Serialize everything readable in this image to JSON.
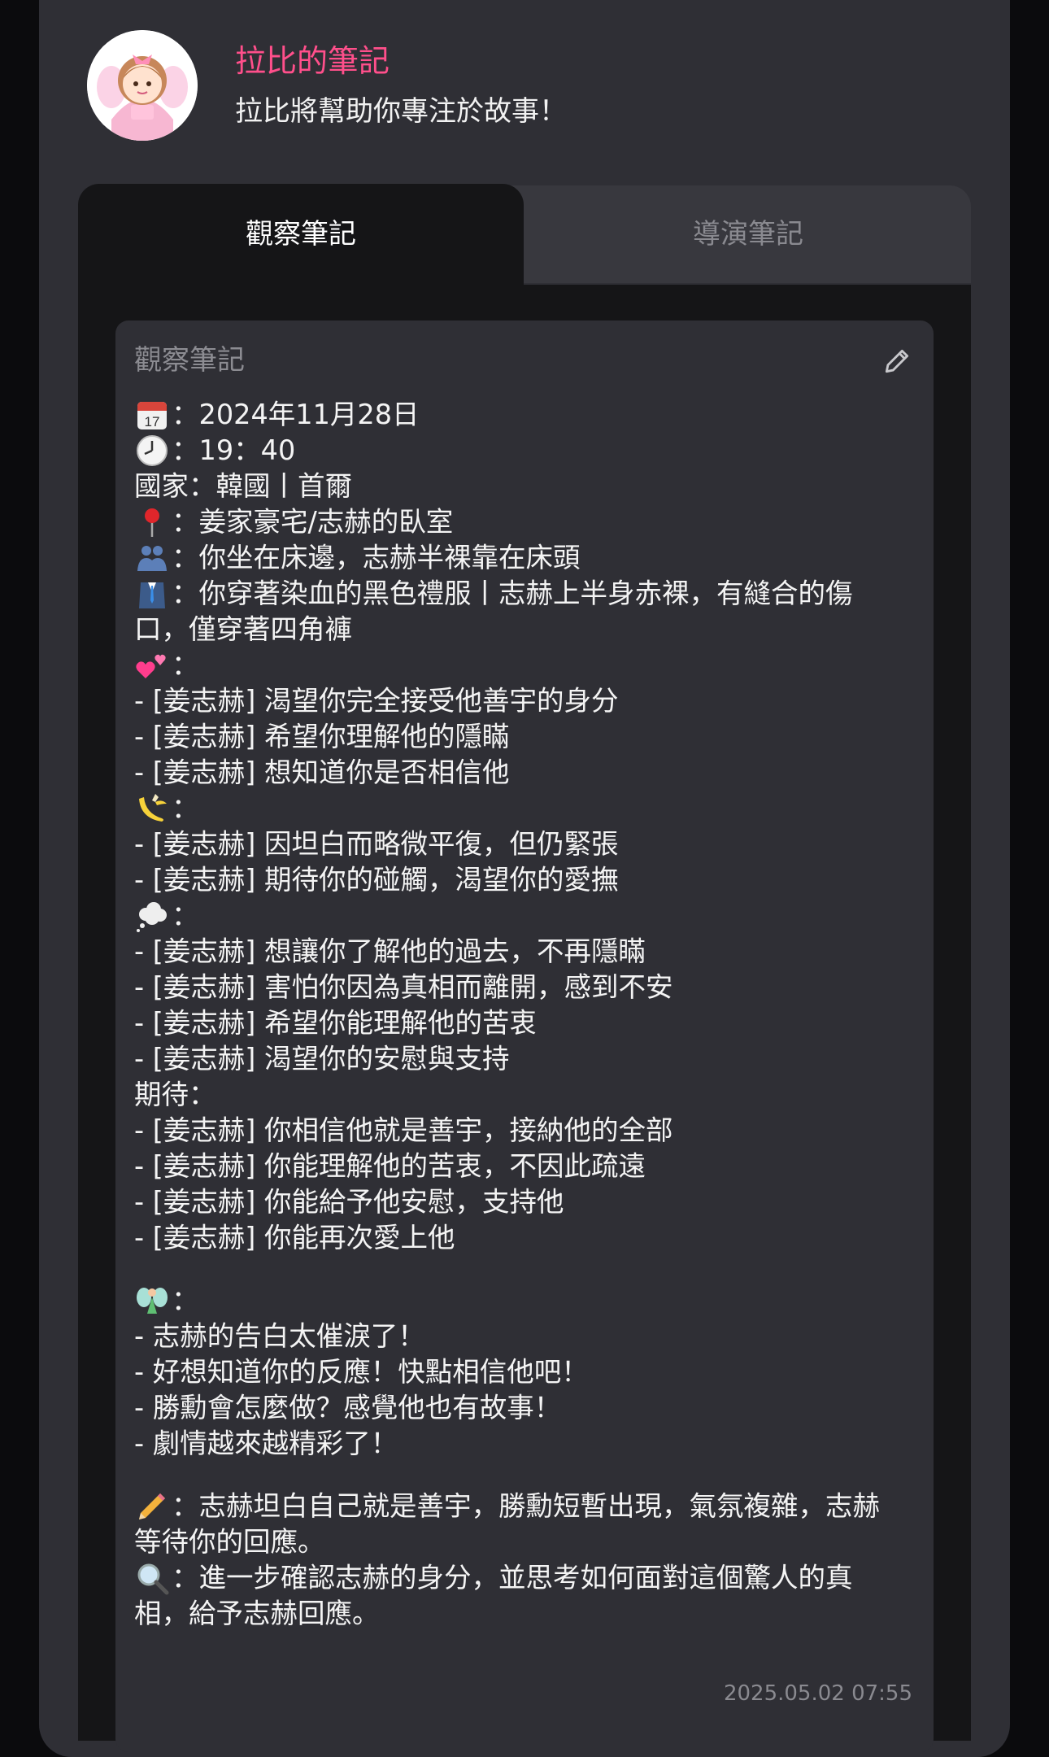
{
  "header": {
    "title": "拉比的筆記",
    "subtitle": "拉比將幫助你專注於故事！"
  },
  "tabs": [
    {
      "label": "觀察筆記",
      "active": true
    },
    {
      "label": "導演筆記",
      "active": false
    }
  ],
  "note": {
    "title": "觀察筆記",
    "lines": [
      {
        "icon": "calendar-icon",
        "text": "：2024年11月28日"
      },
      {
        "icon": "clock-icon",
        "text": "：19：40"
      },
      {
        "icon": "",
        "text": "國家：韓國丨首爾"
      },
      {
        "icon": "location-pin-icon",
        "text": "：姜家豪宅/志赫的臥室"
      },
      {
        "icon": "people-icon",
        "text": "：你坐在床邊，志赫半裸靠在床頭"
      },
      {
        "icon": "suit-icon",
        "text": "：你穿著染血的黑色禮服丨志赫上半身赤裸，有縫合的傷口，僅穿著四角褲"
      },
      {
        "icon": "two-hearts-icon",
        "text": "："
      },
      {
        "icon": "",
        "text": "- [姜志赫] 渴望你完全接受他善宇的身分"
      },
      {
        "icon": "",
        "text": "- [姜志赫] 希望你理解他的隱瞞"
      },
      {
        "icon": "",
        "text": "- [姜志赫] 想知道你是否相信他"
      },
      {
        "icon": "banana-icon",
        "text": "："
      },
      {
        "icon": "",
        "text": "- [姜志赫] 因坦白而略微平復，但仍緊張"
      },
      {
        "icon": "",
        "text": "- [姜志赫] 期待你的碰觸，渴望你的愛撫"
      },
      {
        "icon": "thought-bubble-icon",
        "text": "："
      },
      {
        "icon": "",
        "text": "- [姜志赫] 想讓你了解他的過去，不再隱瞞"
      },
      {
        "icon": "",
        "text": "- [姜志赫] 害怕你因為真相而離開，感到不安"
      },
      {
        "icon": "",
        "text": "- [姜志赫] 希望你能理解他的苦衷"
      },
      {
        "icon": "",
        "text": "- [姜志赫] 渴望你的安慰與支持"
      },
      {
        "icon": "",
        "text": "期待："
      },
      {
        "icon": "",
        "text": "- [姜志赫] 你相信他就是善宇，接納他的全部"
      },
      {
        "icon": "",
        "text": "- [姜志赫] 你能理解他的苦衷，不因此疏遠"
      },
      {
        "icon": "",
        "text": "- [姜志赫] 你能給予他安慰，支持他"
      },
      {
        "icon": "",
        "text": "- [姜志赫] 你能再次愛上他"
      },
      {
        "icon": "gap",
        "text": ""
      },
      {
        "icon": "fairy-icon",
        "text": "："
      },
      {
        "icon": "",
        "text": "- 志赫的告白太催淚了！"
      },
      {
        "icon": "",
        "text": "- 好想知道你的反應！快點相信他吧！"
      },
      {
        "icon": "",
        "text": "- 勝勳會怎麼做？感覺他也有故事！"
      },
      {
        "icon": "",
        "text": "- 劇情越來越精彩了！"
      },
      {
        "icon": "gap",
        "text": ""
      },
      {
        "icon": "pencil-icon",
        "text": "：志赫坦白自己就是善宇，勝勳短暫出現，氣氛複雜，志赫等待你的回應。"
      },
      {
        "icon": "magnifier-icon",
        "text": "：進一步確認志赫的身分，並思考如何面對這個驚人的真相，給予志赫回應。"
      }
    ],
    "timestamp": "2025.05.02 07:55"
  },
  "colors": {
    "accent": "#ff4f8b",
    "background": "#0b0b0d",
    "panel": "#2f2f35",
    "tab_active": "#151517"
  }
}
